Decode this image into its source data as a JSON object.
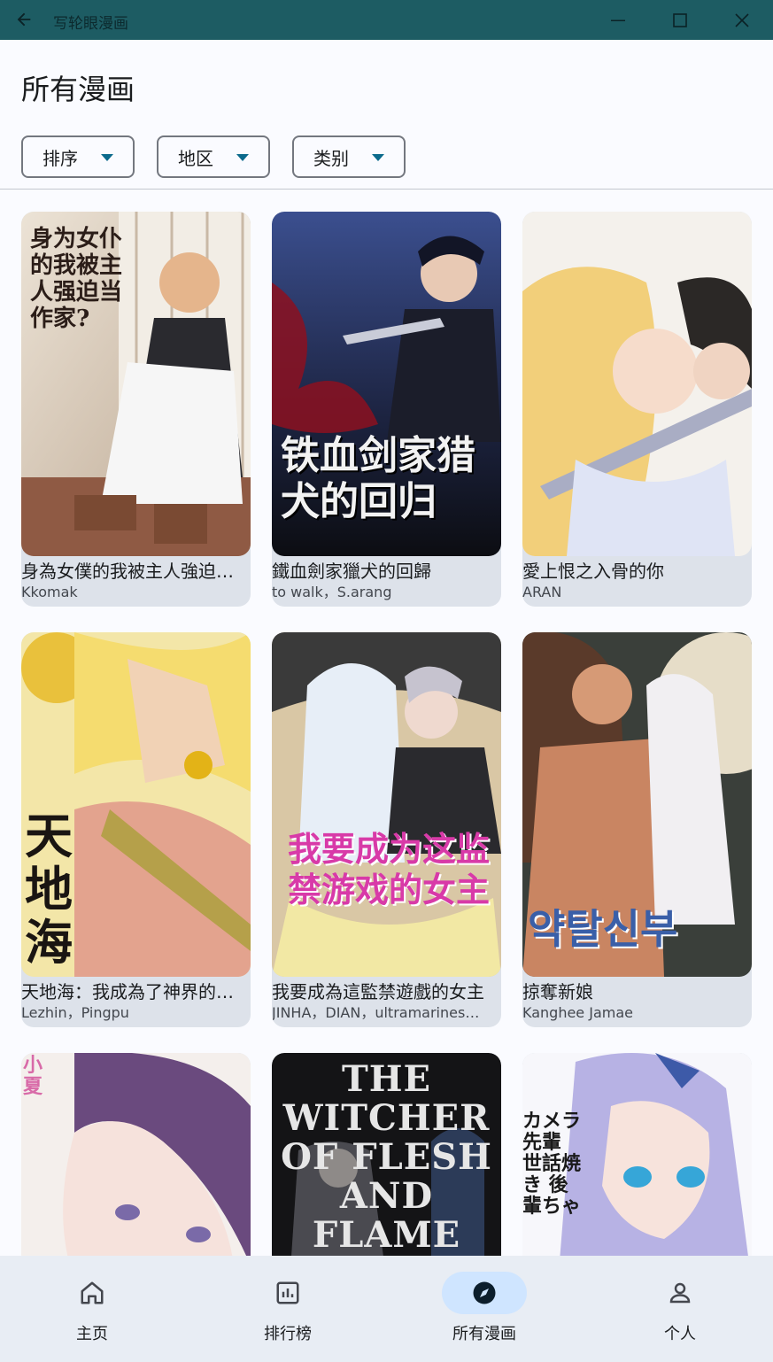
{
  "window": {
    "title": "写轮眼漫画",
    "back_icon": "arrow-back-icon",
    "controls": [
      "minimize-icon",
      "maximize-icon",
      "close-icon"
    ]
  },
  "page": {
    "title": "所有漫画"
  },
  "filters": [
    {
      "label": "排序"
    },
    {
      "label": "地区"
    },
    {
      "label": "类别"
    }
  ],
  "comics": [
    {
      "title": "身為女僕的我被主人強迫…",
      "author": "Kkomak",
      "cover_text": "身为女仆的我被主人强迫当作家?"
    },
    {
      "title": "鐵血劍家獵犬的回歸",
      "author": "to walk，S.arang",
      "cover_text": "铁血剑家猎犬的回归"
    },
    {
      "title": "愛上恨之入骨的你",
      "author": "ARAN",
      "cover_text": ""
    },
    {
      "title": "天地海：我成為了神界的…",
      "author": "Lezhin，Pingpu",
      "cover_text": "天地海"
    },
    {
      "title": "我要成為這監禁遊戲的女主",
      "author": "JINHA，DIAN，ultramarines…",
      "cover_text": "我要成为这监禁游戏的女主"
    },
    {
      "title": "掠奪新娘",
      "author": "Kanghee Jamae",
      "cover_text": "약탈신부"
    },
    {
      "title": "",
      "author": "",
      "cover_text": "小夏"
    },
    {
      "title": "",
      "author": "",
      "cover_text": "THE WITCHER OF FLESH AND FLAME"
    },
    {
      "title": "",
      "author": "",
      "cover_text": "カメラ先輩 世話焼き 後輩ちゃ"
    }
  ],
  "bottom_nav": [
    {
      "label": "主页",
      "icon": "home-icon",
      "active": false
    },
    {
      "label": "排行榜",
      "icon": "leaderboard-icon",
      "active": false
    },
    {
      "label": "所有漫画",
      "icon": "explore-icon",
      "active": true
    },
    {
      "label": "个人",
      "icon": "person-icon",
      "active": false
    }
  ],
  "colors": {
    "titlebar": "#1d5c63",
    "accent": "#0b6a8c",
    "card_bg": "#dde2ea",
    "nav_bg": "#e8edf4",
    "nav_active": "#cfe5ff"
  }
}
